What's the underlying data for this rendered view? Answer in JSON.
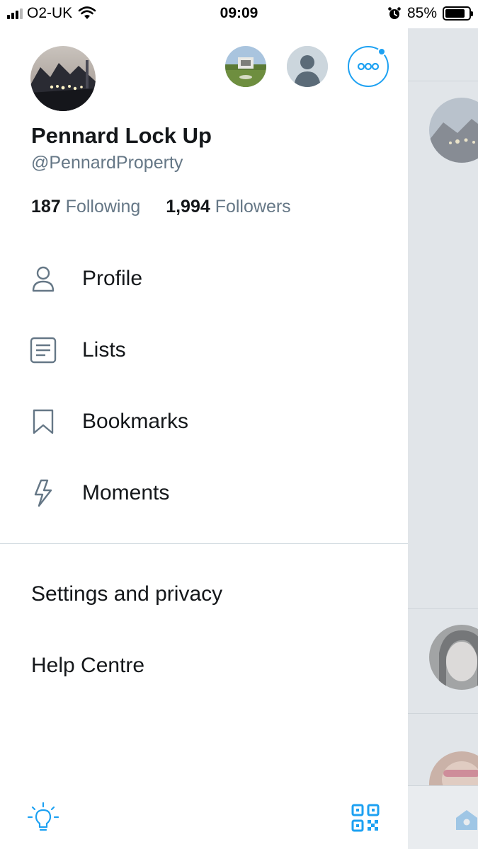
{
  "status_bar": {
    "carrier": "O2-UK",
    "time": "09:09",
    "battery_percent": "85%",
    "battery_level": 0.85,
    "icons": [
      "signal-icon",
      "wifi-icon",
      "alarm-icon",
      "battery-icon"
    ]
  },
  "profile": {
    "display_name": "Pennard Lock Up",
    "handle": "@PennardProperty",
    "following_count": "187",
    "following_label": "Following",
    "followers_count": "1,994",
    "followers_label": "Followers"
  },
  "accounts": {
    "icons": [
      "account-avatar",
      "default-avatar-icon",
      "more-accounts-icon"
    ],
    "accent": "#1da1f2"
  },
  "menu": {
    "items": [
      {
        "label": "Profile",
        "icon": "person-icon"
      },
      {
        "label": "Lists",
        "icon": "lists-icon"
      },
      {
        "label": "Bookmarks",
        "icon": "bookmark-icon"
      },
      {
        "label": "Moments",
        "icon": "lightning-icon"
      }
    ],
    "icon_color": "#657786"
  },
  "secondary": {
    "settings_label": "Settings and privacy",
    "help_label": "Help Centre"
  },
  "footer": {
    "icons": [
      "lightbulb-icon",
      "qr-code-icon"
    ],
    "color": "#1da1f2"
  }
}
